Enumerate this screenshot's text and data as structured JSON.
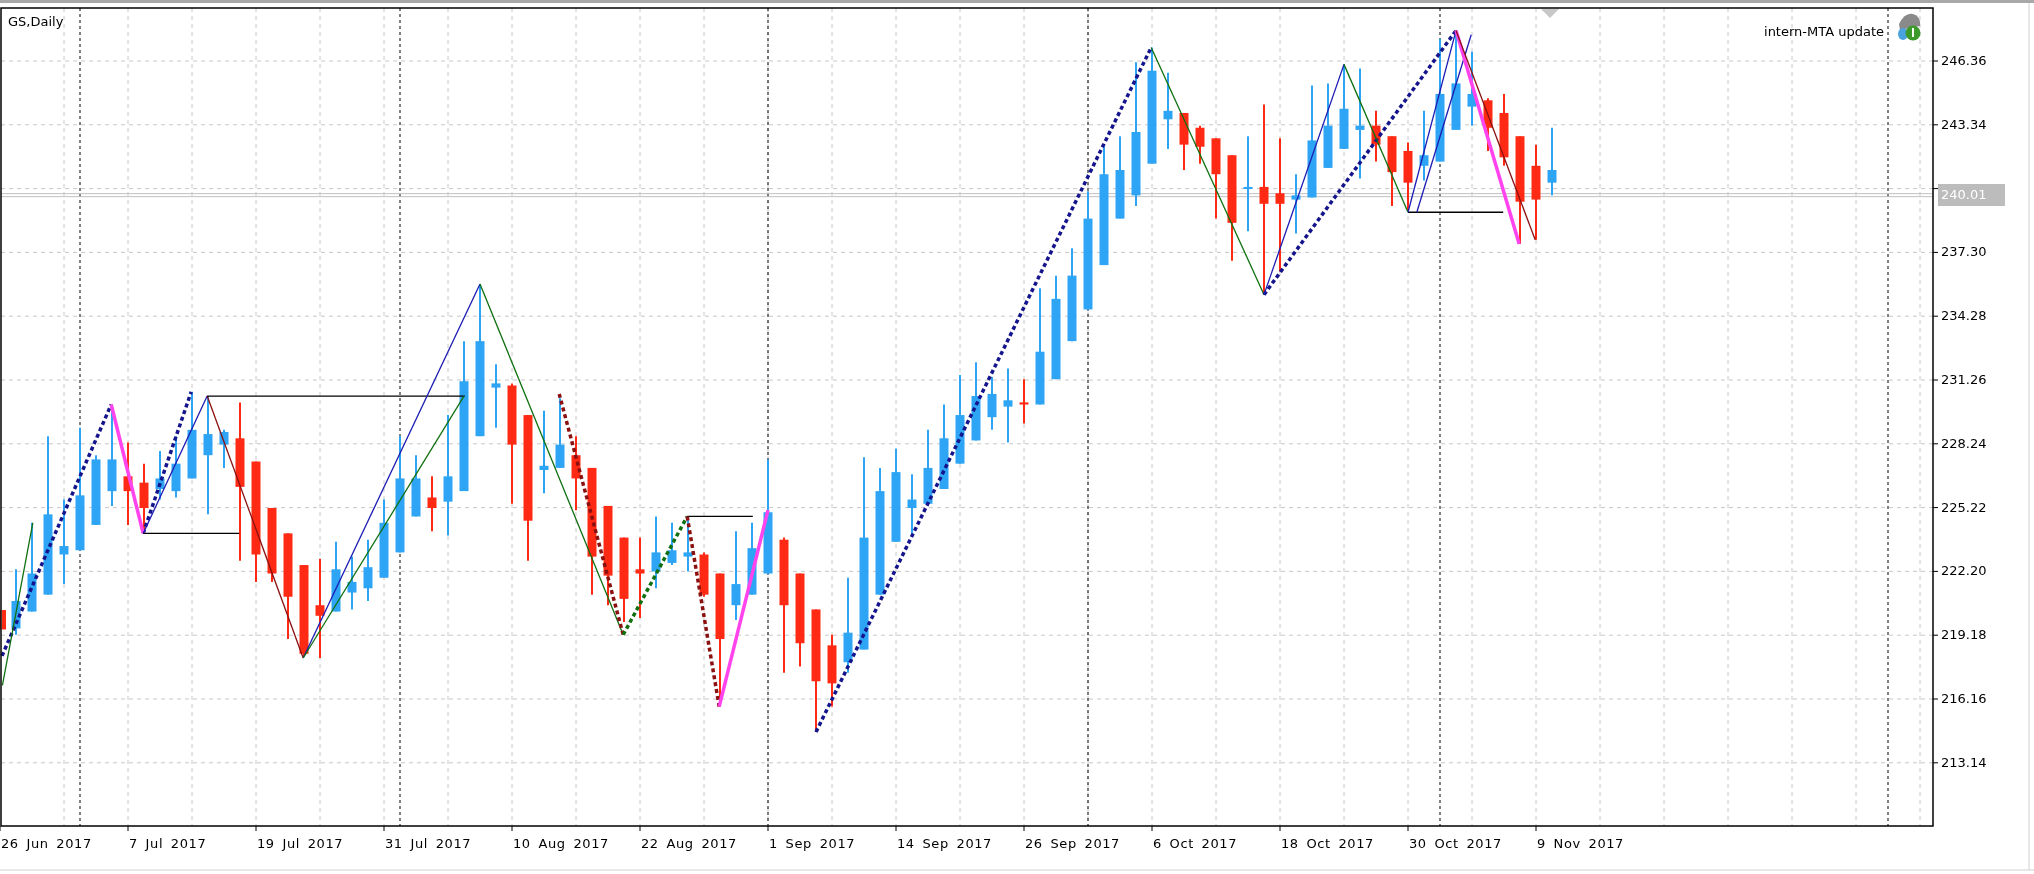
{
  "chart": {
    "symbol_label": "GS,Daily",
    "indicator_label": "intern-MTA update",
    "current_price": "240.01",
    "price_axis": [
      "246.36",
      "243.34",
      "237.30",
      "234.28",
      "231.26",
      "228.24",
      "225.22",
      "222.20",
      "219.18",
      "216.16",
      "213.14"
    ],
    "date_axis": [
      "26 Jun 2017",
      "7 Jul 2017",
      "19 Jul 2017",
      "31 Jul 2017",
      "10 Aug 2017",
      "22 Aug 2017",
      "1 Sep 2017",
      "14 Sep 2017",
      "26 Sep 2017",
      "6 Oct 2017",
      "18 Oct 2017",
      "30 Oct 2017",
      "9 Nov 2017"
    ]
  }
}
